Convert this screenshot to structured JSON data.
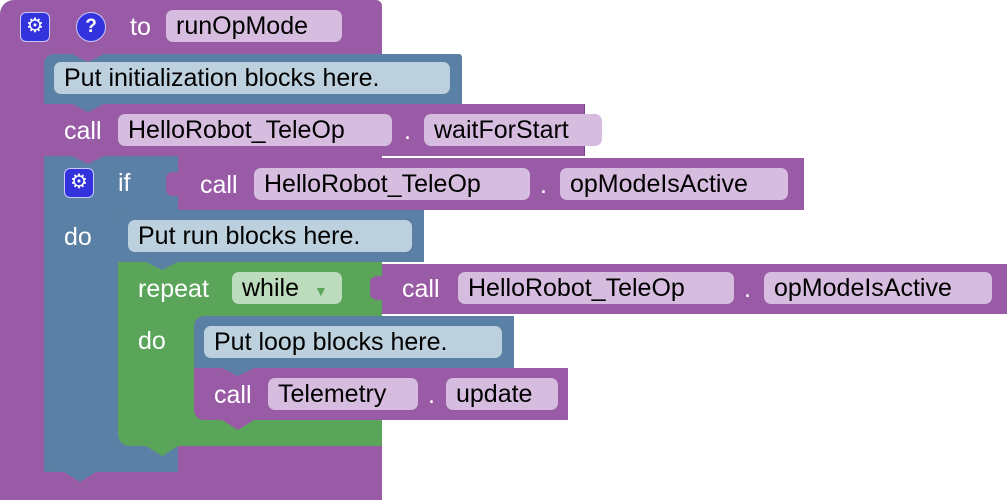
{
  "procedure": {
    "gear_icon": "gear-icon",
    "help_icon": "help-icon",
    "to_label": "to",
    "name": "runOpMode",
    "color": "#995ba5"
  },
  "init_comment": "Put initialization blocks here.",
  "wait_call": {
    "call_label": "call",
    "object": "HelloRobot_TeleOp",
    "dot": ".",
    "method": "waitForStart"
  },
  "if_block": {
    "gear_icon": "gear-icon",
    "if_label": "if",
    "do_label": "do",
    "condition": {
      "call_label": "call",
      "object": "HelloRobot_TeleOp",
      "dot": ".",
      "method": "opModeIsActive"
    },
    "color": "#5b80a5"
  },
  "run_comment": "Put run blocks here.",
  "repeat_block": {
    "repeat_label": "repeat",
    "mode": "while",
    "do_label": "do",
    "condition": {
      "call_label": "call",
      "object": "HelloRobot_TeleOp",
      "dot": ".",
      "method": "opModeIsActive"
    },
    "color": "#5ba55b"
  },
  "loop_comment": "Put loop blocks here.",
  "telemetry_call": {
    "call_label": "call",
    "object": "Telemetry",
    "dot": ".",
    "method": "update"
  }
}
